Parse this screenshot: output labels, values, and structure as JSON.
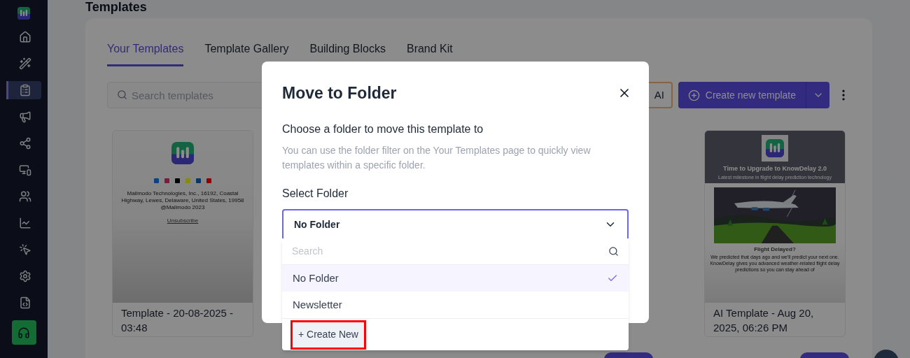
{
  "sidebar": {
    "items": [
      {
        "selected": false
      },
      {
        "selected": false
      },
      {
        "selected": true
      },
      {
        "selected": false
      },
      {
        "selected": false
      },
      {
        "selected": false
      },
      {
        "selected": false
      },
      {
        "selected": false
      },
      {
        "selected": false
      },
      {
        "selected": false
      },
      {
        "selected": false
      }
    ]
  },
  "page": {
    "title": "Templates"
  },
  "tabs": [
    {
      "label": "Your Templates",
      "selected": true
    },
    {
      "label": "Template Gallery",
      "selected": false
    },
    {
      "label": "Building Blocks",
      "selected": false
    },
    {
      "label": "Brand Kit",
      "selected": false
    }
  ],
  "search": {
    "placeholder": "Search templates"
  },
  "ai_button": {
    "label": "AI"
  },
  "create_button": {
    "label": "Create new template"
  },
  "cards": [
    {
      "kind": "footer",
      "preview": {
        "address": "Mailmodo Technologies, Inc., 16192, Coastal Highway, Lewes, Delaware, United States, 19958",
        "copyright": "@Mailmodo 2023",
        "link": "Unsubscribe"
      },
      "name": "Template - 20-08-2025 - 03:48"
    },
    {
      "kind": "newsletter",
      "preview": {
        "headline": "Time to Upgrade to KnowDelay 2.0",
        "subline": "Latest milestone in flight delay prediction technology",
        "heading": "Flight Delayed?",
        "body": "We predicted that days ago and we'll predict your next one. KnowDelay gives you advanced weather-related flight delay predictions so you can stay ahead of"
      },
      "name": "AI Template - Aug 20, 2025, 06:26 PM"
    }
  ],
  "dialog": {
    "title": "Move to Folder",
    "subtitle": "Choose a folder to move this template to",
    "description": "You can use the folder filter on the Your Templates page to quickly view templates within a specific folder.",
    "field_label": "Select Folder",
    "value": "No Folder",
    "dropdown": {
      "placeholder": "Search",
      "options": [
        {
          "label": "No Folder",
          "selected": true
        },
        {
          "label": "Newsletter",
          "selected": false
        }
      ],
      "create": {
        "label": "+ Create New",
        "highlighted": true
      }
    }
  }
}
